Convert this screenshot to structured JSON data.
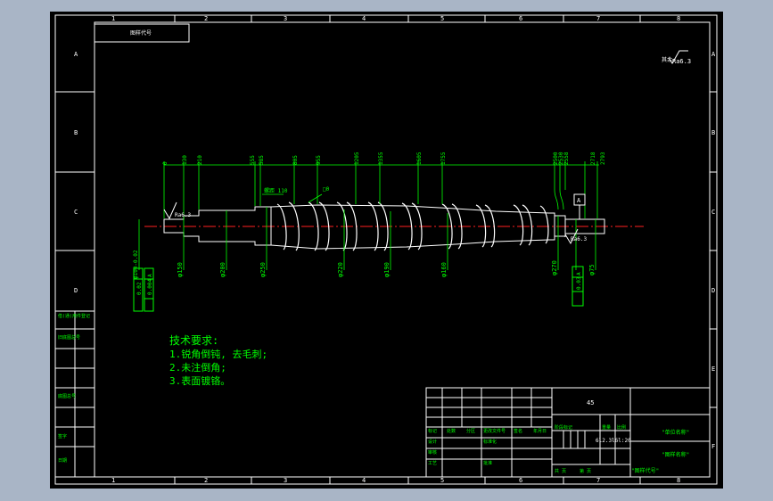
{
  "grid": {
    "columns": [
      "1",
      "2",
      "3",
      "4",
      "5",
      "6",
      "7",
      "8"
    ],
    "rows_left": [
      "A",
      "B",
      "C",
      "D"
    ],
    "rows_right": [
      "A",
      "B",
      "C",
      "D",
      "E",
      "F"
    ]
  },
  "title_block": {
    "material": "45",
    "drawing_no": "6l2.3l6l:20",
    "company": "\"单位名称\"",
    "drawing_title": "\"图样名称\"",
    "drawing_code": "\"图样代号\"",
    "scale_label": "比例",
    "small_labels": [
      "标记",
      "处数",
      "分区",
      "更改文件号",
      "签名",
      "年月日",
      "设计",
      "标准化",
      "阶段标记",
      "重量",
      "审核",
      "工艺",
      "批准",
      "共 页",
      "第 页"
    ]
  },
  "roughness": {
    "symbol_text": "其余",
    "value": "Ra6.3"
  },
  "top_left_box": "图样代号",
  "left_strip": [
    "借(通)用件登记",
    "旧底图总号",
    "底图总号",
    "签字",
    "日期"
  ],
  "tech_requirements": {
    "title": "技术要求:",
    "items": [
      "1.锐角倒钝, 去毛刺;",
      "2.未注倒角;",
      "3.表面镀铬。"
    ]
  },
  "dimensions": {
    "top": [
      "0",
      "130",
      "210",
      "555",
      "585",
      "805",
      "955",
      "1205",
      "1355",
      "1605",
      "1755",
      "2500",
      "2530",
      "2558",
      "2718",
      "2793"
    ],
    "diameters": [
      "φ150",
      "φ200",
      "φ250",
      "φ220",
      "φ190",
      "φ160",
      "φ270",
      "φ75"
    ],
    "pitch": "螺距 110",
    "flat": "□0",
    "roughness_left": "Ra6.3",
    "roughness_right": "Ra6.3",
    "datum": "A",
    "tol_left": [
      "0.02",
      "0.004",
      "A"
    ],
    "tol_right": [
      "0.03",
      "A"
    ],
    "left_dia": "φ100-0.02"
  }
}
